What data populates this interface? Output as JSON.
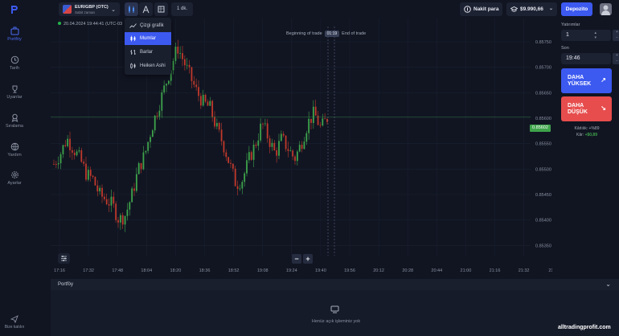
{
  "sidebar": {
    "items": [
      {
        "label": "Portföy",
        "icon": "briefcase-icon",
        "active": true
      },
      {
        "label": "Tarih",
        "icon": "clock-icon"
      },
      {
        "label": "Uyarılar",
        "icon": "trophy-icon"
      },
      {
        "label": "Sıralama",
        "icon": "award-icon"
      },
      {
        "label": "Yardım",
        "icon": "globe-icon"
      },
      {
        "label": "Ayarlar",
        "icon": "gear-icon"
      }
    ],
    "back_label": "Bize katılın"
  },
  "topbar": {
    "asset_name": "EUR/GBP (OTC)",
    "asset_sub": "Sabit zaman",
    "interval": "1 dk.",
    "cash_label": "Nakit para",
    "balance": "$9.990,66",
    "deposit_label": "Depozito"
  },
  "chart_type_menu": {
    "items": [
      {
        "label": "Çizgi grafik",
        "icon": "line-chart-icon"
      },
      {
        "label": "Mumlar",
        "icon": "candles-icon",
        "selected": true
      },
      {
        "label": "Barlar",
        "icon": "bars-icon"
      },
      {
        "label": "Heiken Ashi",
        "icon": "heiken-ashi-icon"
      }
    ]
  },
  "chart": {
    "timestamp": "20.04.2024 19:44:41 (UTC-03",
    "beginning_label": "Beginning of trade",
    "timer": "01:19",
    "end_label": "End of trade",
    "current_price": "0.85602"
  },
  "chart_data": {
    "type": "candlestick",
    "x_ticks": [
      "17:16",
      "17:32",
      "17:48",
      "18:04",
      "18:20",
      "18:36",
      "18:52",
      "19:08",
      "19:24",
      "19:40",
      "19:56",
      "20:12",
      "20:28",
      "20:44",
      "21:00",
      "21:16",
      "21:32",
      "21:4"
    ],
    "y_ticks": [
      "0.85750",
      "0.85700",
      "0.85650",
      "0.85600",
      "0.85550",
      "0.85500",
      "0.85450",
      "0.85400",
      "0.85350"
    ],
    "ylim": [
      0.8533,
      0.8578
    ],
    "series": [
      {
        "values": [
          0.8551,
          0.8553,
          0.8556,
          0.8554,
          0.8552,
          0.8549,
          0.8548,
          0.8545,
          0.8544,
          0.8543,
          0.854,
          0.8541,
          0.8545,
          0.855,
          0.8553,
          0.8558,
          0.8562,
          0.8566,
          0.857,
          0.8574,
          0.8571,
          0.8568,
          0.8565,
          0.8563,
          0.8562,
          0.8558,
          0.8555,
          0.8551,
          0.8547,
          0.8548,
          0.8552,
          0.8555,
          0.8559,
          0.8556,
          0.8553,
          0.8556,
          0.8554,
          0.8552,
          0.8555,
          0.8559,
          0.8561,
          0.8558,
          0.856
        ]
      }
    ],
    "current_price": 0.85602,
    "grid": true
  },
  "right_panel": {
    "amount_label": "Yatırımlar",
    "amount_value": "1",
    "time_label": "Son",
    "time_value": "19:46",
    "up_label_1": "DAHA",
    "up_label_2": "YÜKSEK",
    "down_label_1": "DAHA",
    "down_label_2": "DÜŞÜK",
    "profit_label": "Kârlılık: +%89",
    "profit_amount_label": "Kâr:",
    "profit_amount": "+$0,89"
  },
  "portfolio": {
    "title": "Portföy",
    "empty_text": "Henüz açık işleminiz yok"
  },
  "watermark": "alltradingprofit.com",
  "colors": {
    "up": "#3ea34b",
    "down": "#c0392b",
    "accent": "#3c59f0",
    "sell": "#e74d4d"
  }
}
